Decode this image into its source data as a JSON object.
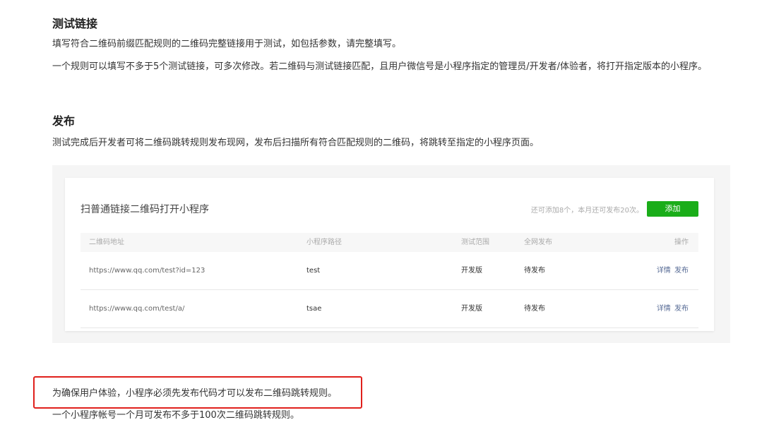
{
  "section_test": {
    "title": "测试链接",
    "para1": "填写符合二维码前缀匹配规则的二维码完整链接用于测试，如包括参数，请完整填写。",
    "para2": "一个规则可以填写不多于5个测试链接，可多次修改。若二维码与测试链接匹配，且用户微信号是小程序指定的管理员/开发者/体验者，将打开指定版本的小程序。"
  },
  "section_publish": {
    "title": "发布",
    "para": "测试完成后开发者可将二维码跳转规则发布现网，发布后扫描所有符合匹配规则的二维码，将跳转至指定的小程序页面。"
  },
  "card": {
    "title": "扫普通链接二维码打开小程序",
    "hint": "还可添加8个，本月还可发布20次。",
    "add_label": "添加",
    "add_color": "#1aad19",
    "columns": [
      "二维码地址",
      "小程序路径",
      "测试范围",
      "全网发布",
      "操作"
    ],
    "rows": [
      {
        "url": "https://www.qq.com/test?id=123",
        "path": "test",
        "scope": "开发版",
        "status": "待发布",
        "detail": "详情",
        "publish": "发布"
      },
      {
        "url": "https://www.qq.com/test/a/",
        "path": "tsae",
        "scope": "开发版",
        "status": "待发布",
        "detail": "详情",
        "publish": "发布"
      }
    ]
  },
  "notes": {
    "highlighted": "为确保用户体验，小程序必须先发布代码才可以发布二维码跳转规则。",
    "limit": "一个小程序帐号一个月可发布不多于100次二维码跳转规则。",
    "highlight_color": "#e0201c"
  }
}
